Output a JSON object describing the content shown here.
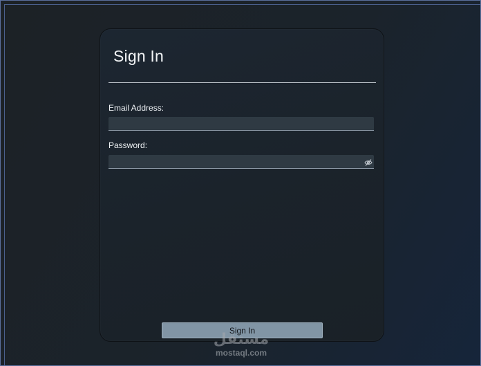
{
  "card": {
    "title": "Sign In"
  },
  "form": {
    "email_label": "Email Address:",
    "email_value": "",
    "password_label": "Password:",
    "password_value": "",
    "password_toggle_icon": "eye-off-icon",
    "submit_label": "Sign In"
  },
  "watermark": {
    "arabic": "مستقل",
    "domain": "mostaql.com"
  },
  "colors": {
    "window_border": "#5a6f9c",
    "card_background": "#1b232b",
    "field_background": "#2f3a43",
    "button_background": "#8195a5"
  }
}
